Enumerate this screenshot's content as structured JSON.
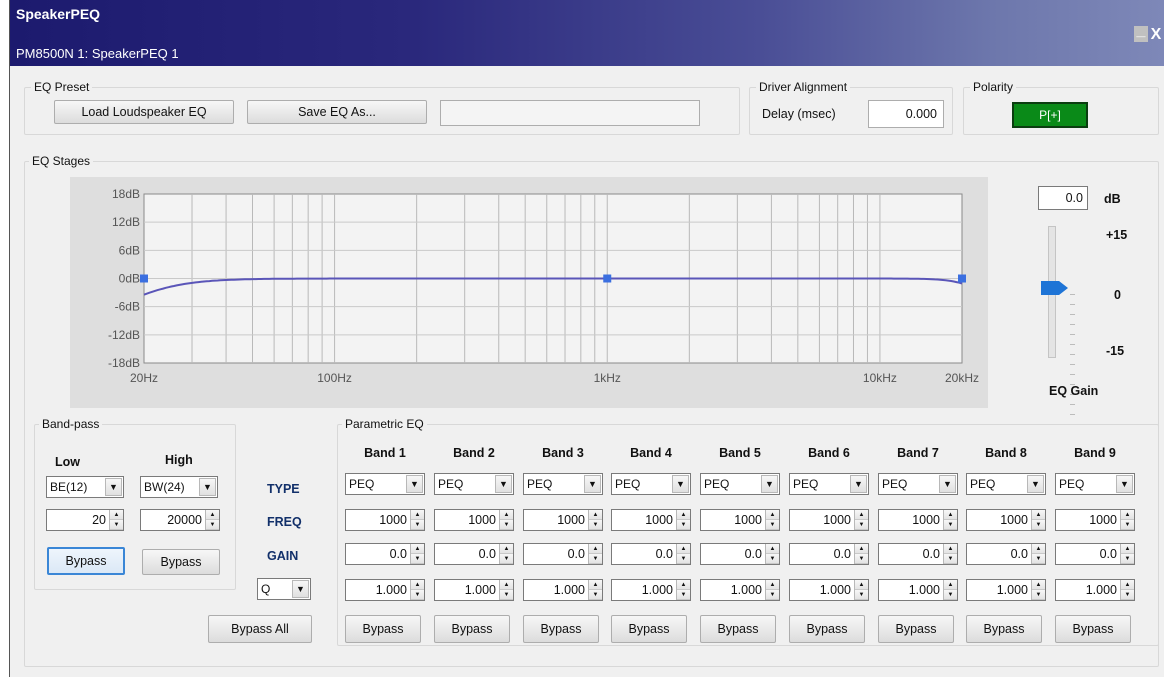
{
  "window": {
    "title": "SpeakerPEQ",
    "subtitle": "PM8500N 1: SpeakerPEQ 1",
    "minimize_label": "_",
    "close_label": "X"
  },
  "eq_preset": {
    "legend": "EQ Preset",
    "load_button": "Load Loudspeaker EQ",
    "save_button": "Save EQ As...",
    "preset_name": ""
  },
  "driver_alignment": {
    "legend": "Driver Alignment",
    "delay_label": "Delay (msec)",
    "delay_value": "0.000"
  },
  "polarity": {
    "legend": "Polarity",
    "value": "P[+]",
    "color": "#0a8a18"
  },
  "eq_stages": {
    "legend": "EQ Stages",
    "graph": {
      "y_labels": [
        "18dB",
        "12dB",
        "6dB",
        "0dB",
        "-6dB",
        "-12dB",
        "-18dB"
      ],
      "x_labels": [
        "20Hz",
        "100Hz",
        "1kHz",
        "10kHz",
        "20kHz"
      ],
      "curve_color": "#5a55b8",
      "handle_color": "#3b6fe0"
    },
    "gain": {
      "value": "0.0",
      "unit": "dB",
      "scale_top": "+15",
      "scale_mid": "0",
      "scale_bottom": "-15",
      "label": "EQ Gain",
      "level_db": 0
    }
  },
  "bandpass": {
    "legend": "Band-pass",
    "low_header": "Low",
    "high_header": "High",
    "low_type": "BE(12)",
    "high_type": "BW(24)",
    "low_freq": "20",
    "high_freq": "20000",
    "low_bypass": "Bypass",
    "high_bypass": "Bypass"
  },
  "row_labels": {
    "type": "TYPE",
    "freq": "FREQ",
    "gain": "GAIN",
    "q_select": "Q",
    "bypass_all": "Bypass All"
  },
  "parametric": {
    "legend": "Parametric EQ",
    "bands": [
      {
        "name": "Band 1",
        "type": "PEQ",
        "freq": "1000",
        "gain": "0.0",
        "q": "1.000",
        "bypass": "Bypass"
      },
      {
        "name": "Band 2",
        "type": "PEQ",
        "freq": "1000",
        "gain": "0.0",
        "q": "1.000",
        "bypass": "Bypass"
      },
      {
        "name": "Band 3",
        "type": "PEQ",
        "freq": "1000",
        "gain": "0.0",
        "q": "1.000",
        "bypass": "Bypass"
      },
      {
        "name": "Band 4",
        "type": "PEQ",
        "freq": "1000",
        "gain": "0.0",
        "q": "1.000",
        "bypass": "Bypass"
      },
      {
        "name": "Band 5",
        "type": "PEQ",
        "freq": "1000",
        "gain": "0.0",
        "q": "1.000",
        "bypass": "Bypass"
      },
      {
        "name": "Band 6",
        "type": "PEQ",
        "freq": "1000",
        "gain": "0.0",
        "q": "1.000",
        "bypass": "Bypass"
      },
      {
        "name": "Band 7",
        "type": "PEQ",
        "freq": "1000",
        "gain": "0.0",
        "q": "1.000",
        "bypass": "Bypass"
      },
      {
        "name": "Band 8",
        "type": "PEQ",
        "freq": "1000",
        "gain": "0.0",
        "q": "1.000",
        "bypass": "Bypass"
      },
      {
        "name": "Band 9",
        "type": "PEQ",
        "freq": "1000",
        "gain": "0.0",
        "q": "1.000",
        "bypass": "Bypass"
      }
    ]
  },
  "icons": {
    "dropdown": "chevron-down-icon",
    "spin_up": "spin-up-icon",
    "spin_down": "spin-down-icon"
  }
}
